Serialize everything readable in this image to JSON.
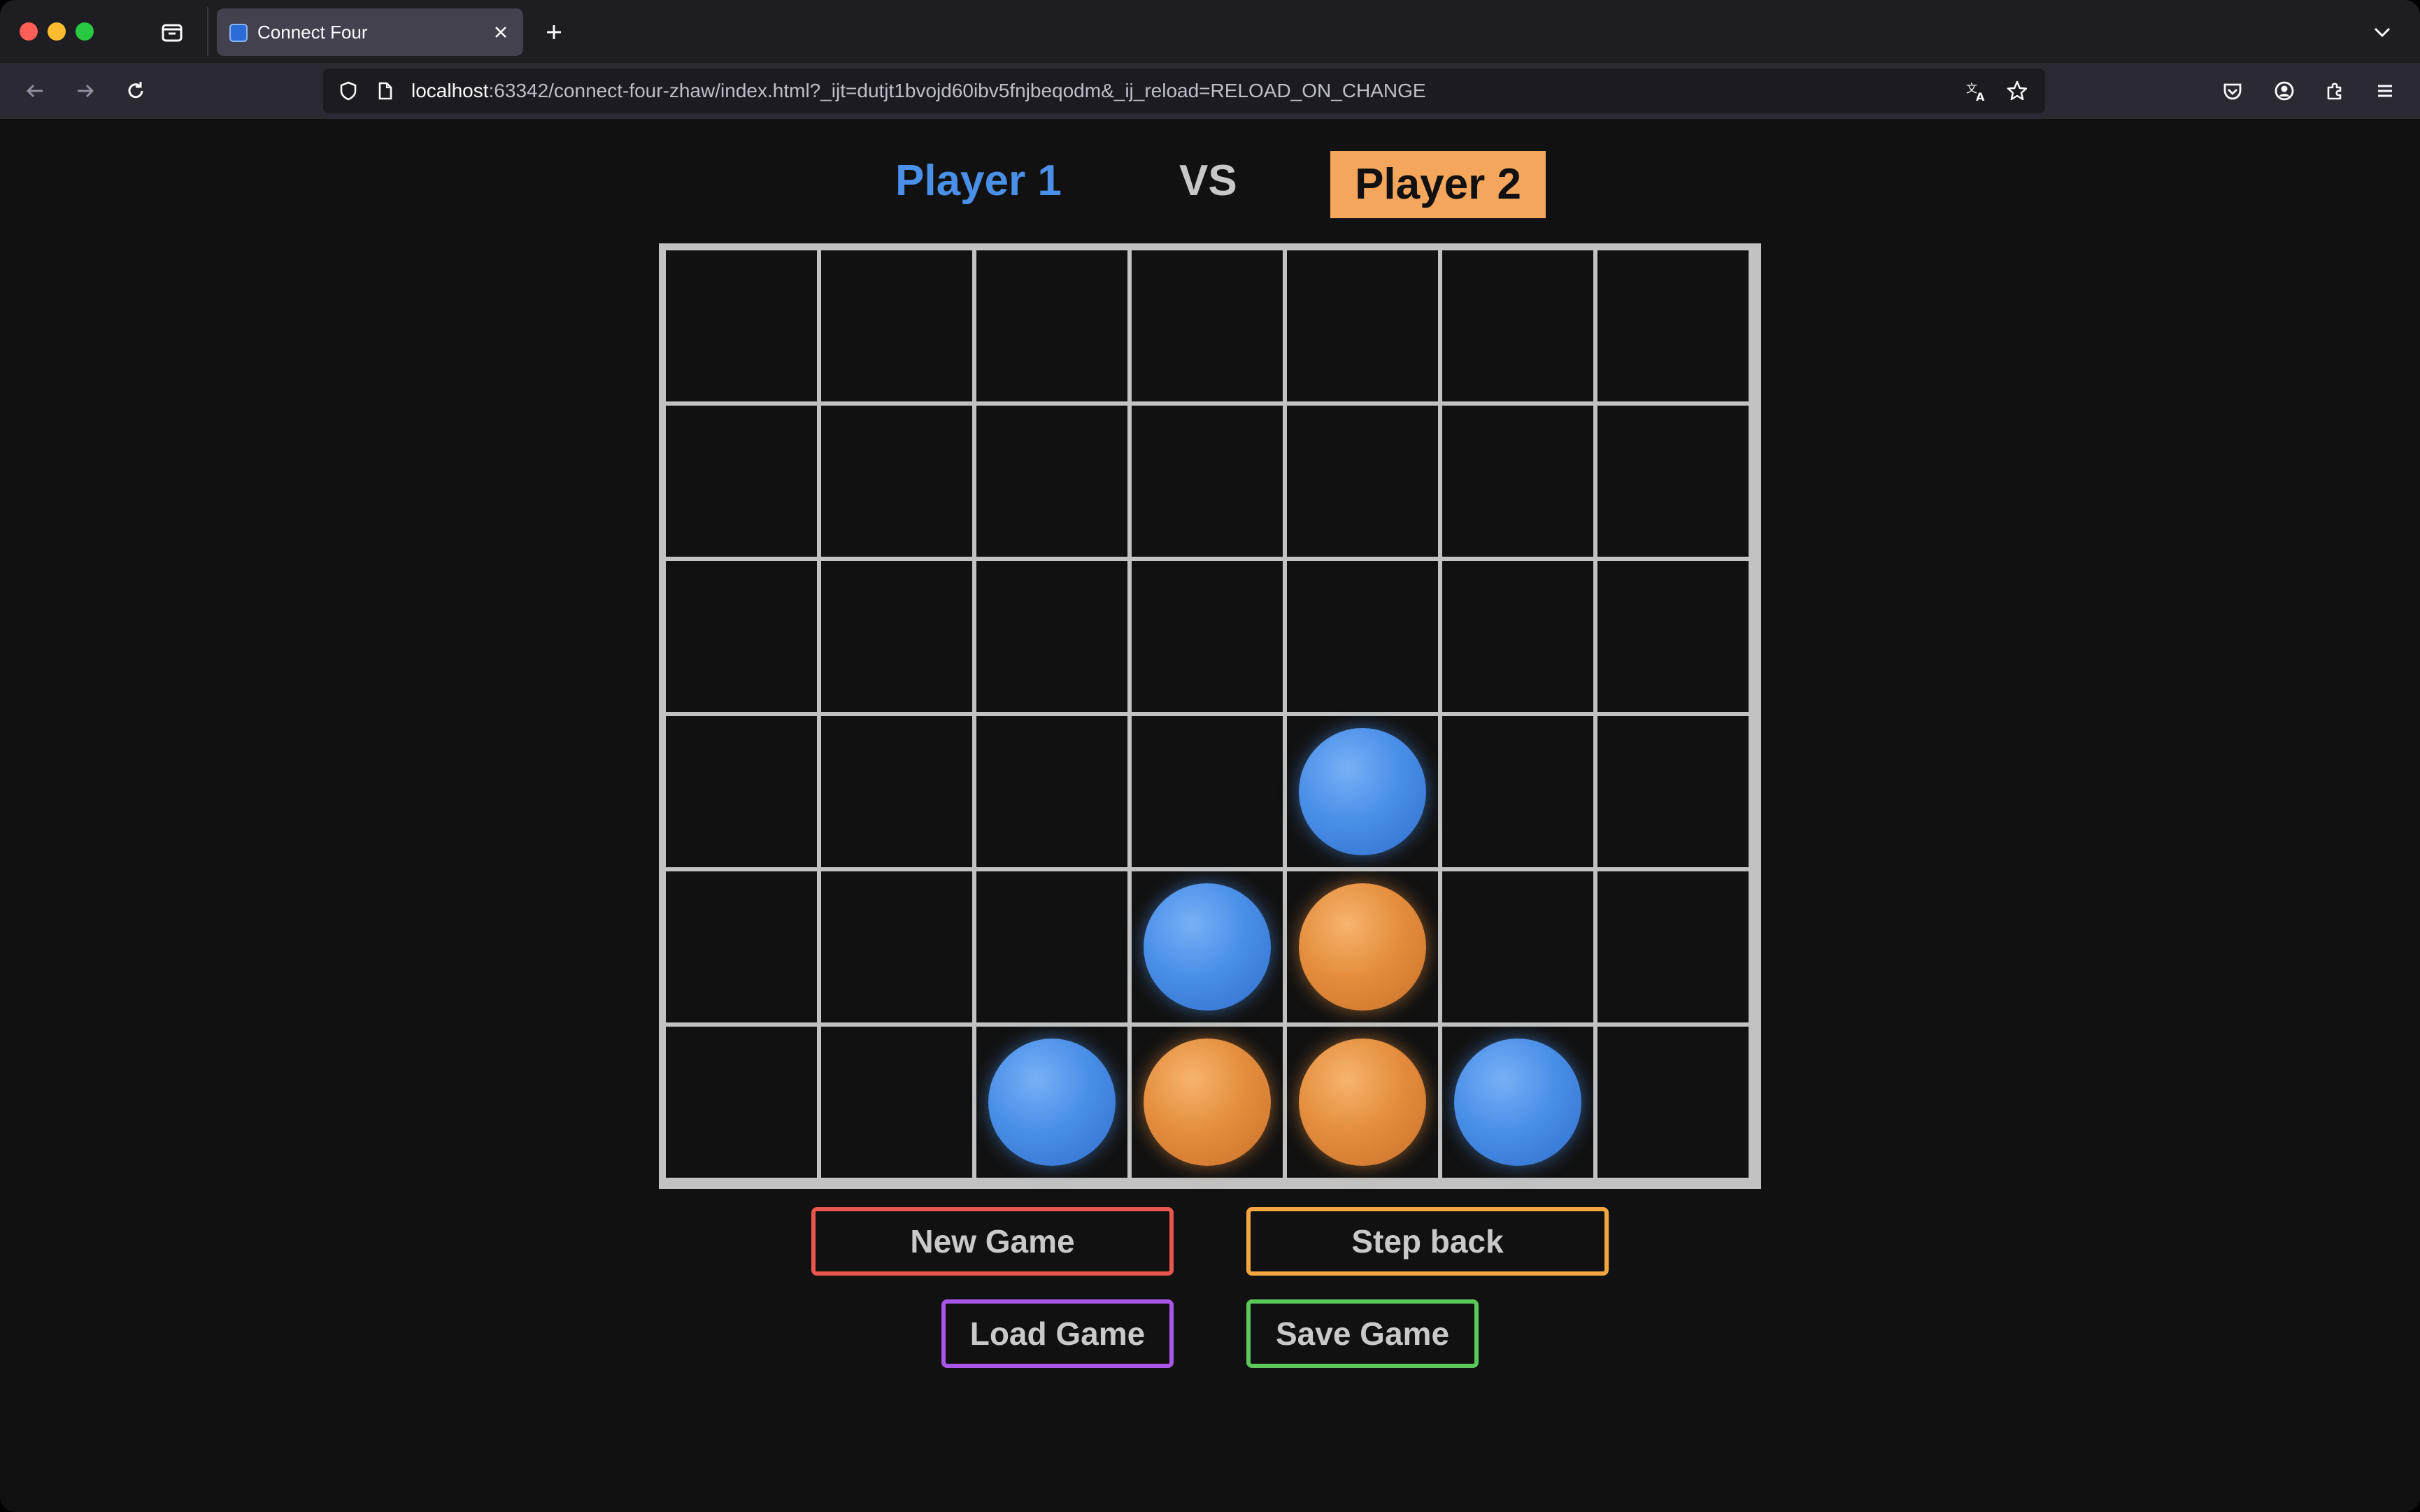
{
  "browser": {
    "tab_title": "Connect Four",
    "url_host": "localhost",
    "url_rest": ":63342/connect-four-zhaw/index.html?_ijt=dutjt1bvojd60ibv5fnjbeqodm&_ij_reload=RELOAD_ON_CHANGE",
    "icons": [
      "tabs-icon",
      "close-icon",
      "plus-icon",
      "chevron-down-icon",
      "back-icon",
      "forward-icon",
      "reload-icon",
      "shield-icon",
      "page-icon",
      "translate-icon",
      "star-icon",
      "pocket-icon",
      "account-icon",
      "extensions-icon",
      "menu-icon"
    ]
  },
  "game": {
    "player1_label": "Player 1",
    "vs_label": "VS",
    "player2_label": "Player 2",
    "active_player": "Player 2",
    "colors": {
      "player1": "#4a8fe8",
      "player2": "#f3a65c"
    },
    "board": {
      "rows": 6,
      "columns": 7,
      "cells": [
        [
          "",
          "",
          "",
          "",
          "",
          "",
          ""
        ],
        [
          "",
          "",
          "",
          "",
          "",
          "",
          ""
        ],
        [
          "",
          "",
          "",
          "",
          "",
          "",
          ""
        ],
        [
          "",
          "",
          "",
          "",
          "blue",
          "",
          ""
        ],
        [
          "",
          "",
          "",
          "blue",
          "orange",
          "",
          ""
        ],
        [
          "",
          "",
          "blue",
          "orange",
          "orange",
          "blue",
          ""
        ]
      ]
    }
  },
  "controls": {
    "new_game": {
      "label": "New Game",
      "color": "#e8564e"
    },
    "step_back": {
      "label": "Step back",
      "color": "#f3a640"
    },
    "load_game": {
      "label": "Load Game",
      "color": "#a855e8"
    },
    "save_game": {
      "label": "Save Game",
      "color": "#5ac85a"
    }
  }
}
